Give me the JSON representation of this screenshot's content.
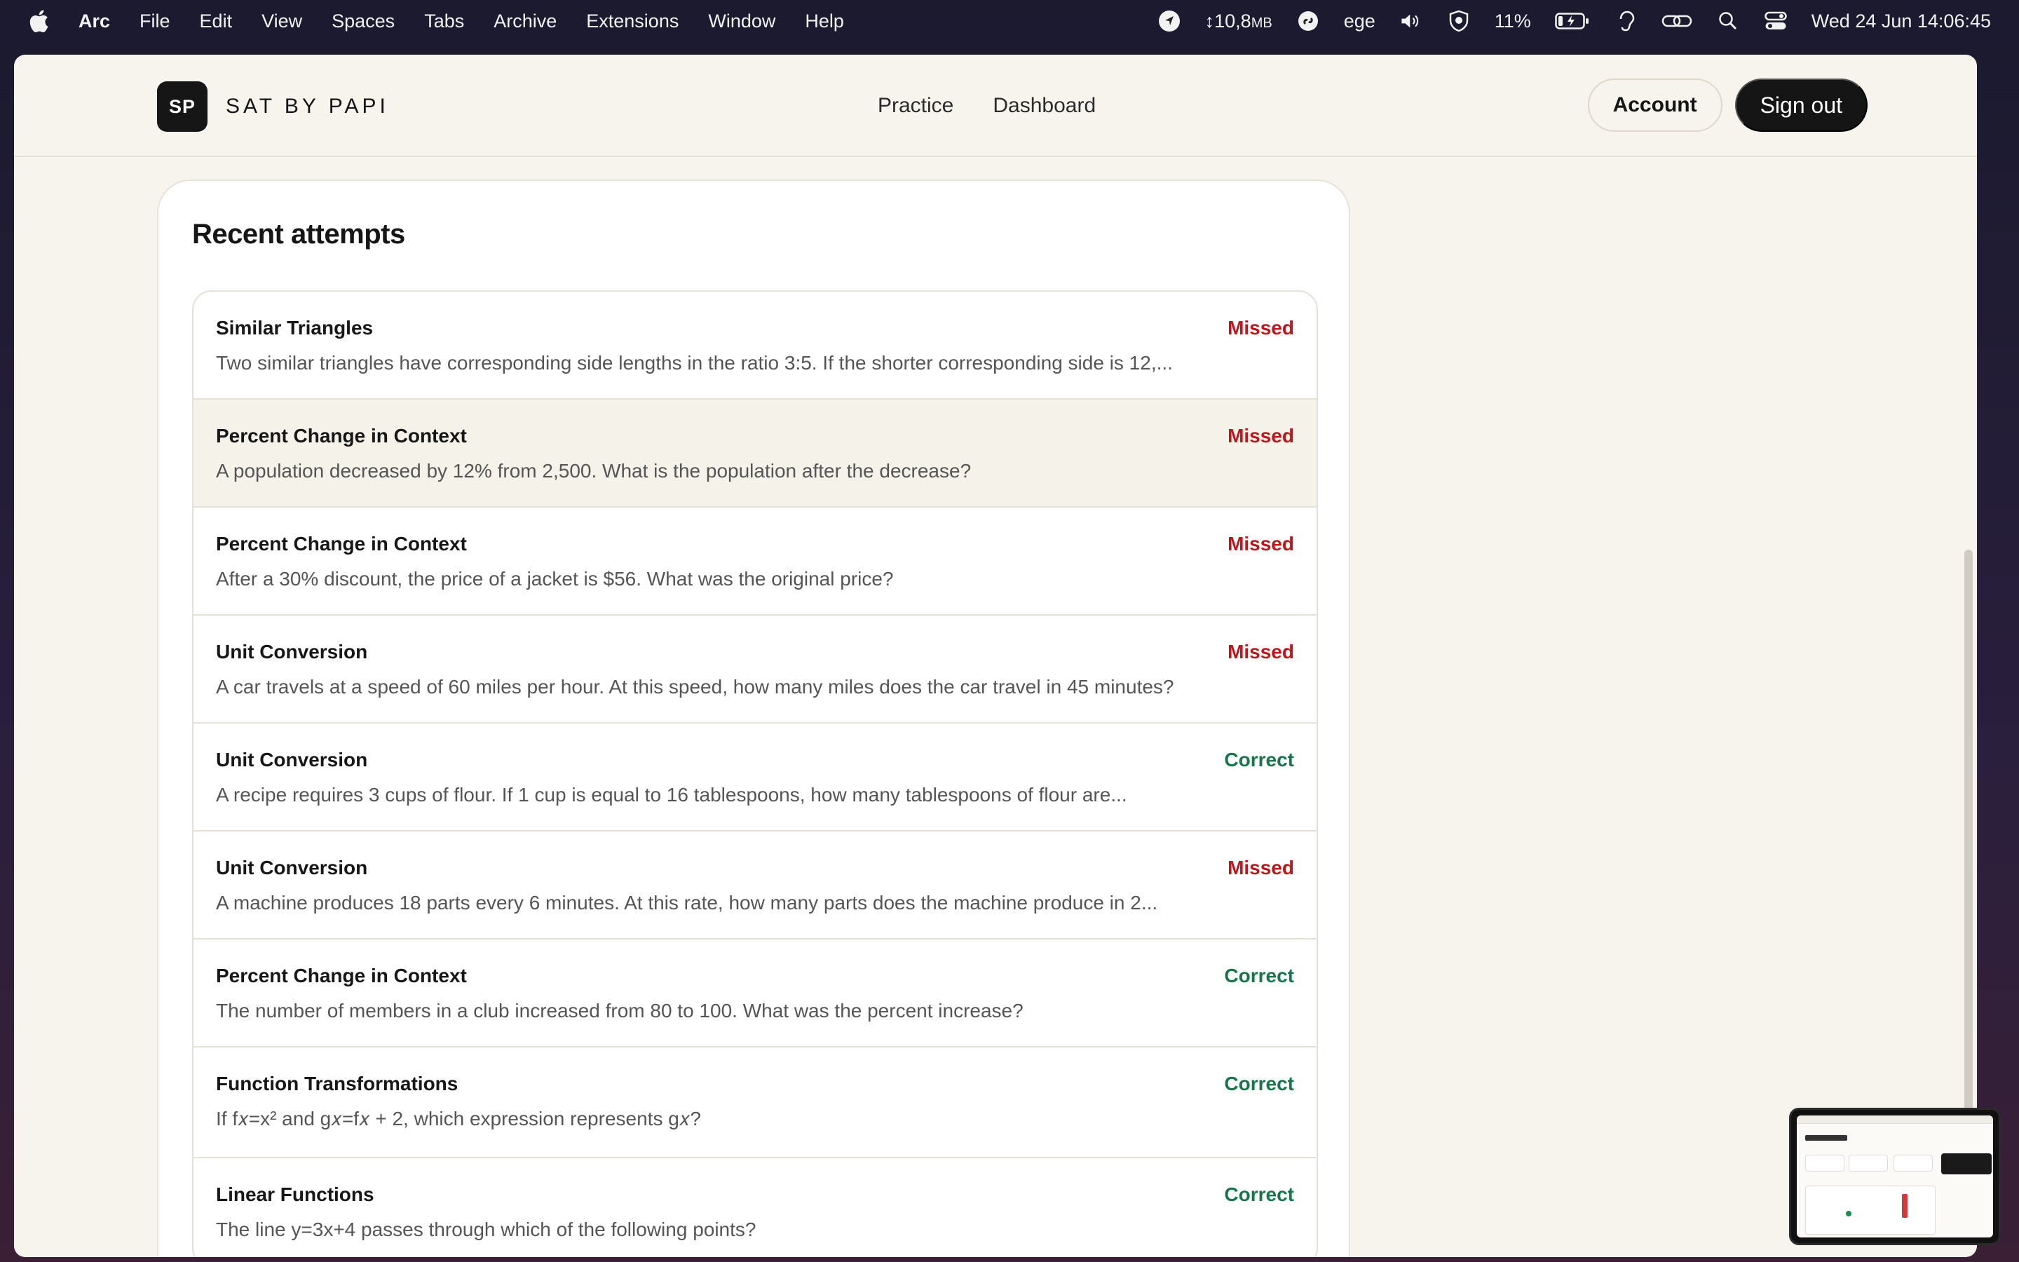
{
  "menubar": {
    "app_name": "Arc",
    "menus": [
      "File",
      "Edit",
      "View",
      "Spaces",
      "Tabs",
      "Archive",
      "Extensions",
      "Window",
      "Help"
    ],
    "network_rate": "↕10,8",
    "network_unit": "MB",
    "keyboard_label": "ege",
    "battery_percent": "11%",
    "datetime": "Wed 24 Jun  14:06:45"
  },
  "header": {
    "logo_initials": "SP",
    "brand_name": "SAT BY PAPI",
    "nav": [
      "Practice",
      "Dashboard"
    ],
    "account_label": "Account",
    "signout_label": "Sign out"
  },
  "recent": {
    "title": "Recent attempts",
    "attempts": [
      {
        "topic": "Similar Triangles",
        "question": "Two similar triangles have corresponding side lengths in the ratio 3:5. If the shorter corresponding side is 12,...",
        "status": "Missed"
      },
      {
        "topic": "Percent Change in Context",
        "question": "A population decreased by 12% from 2,500. What is the population after the decrease?",
        "status": "Missed"
      },
      {
        "topic": "Percent Change in Context",
        "question": "After a 30% discount, the price of a jacket is $56. What was the original price?",
        "status": "Missed"
      },
      {
        "topic": "Unit Conversion",
        "question": "A car travels at a speed of 60 miles per hour. At this speed, how many miles does the car travel in 45 minutes?",
        "status": "Missed"
      },
      {
        "topic": "Unit Conversion",
        "question": "A recipe requires 3 cups of flour. If 1 cup is equal to 16 tablespoons, how many tablespoons of flour are...",
        "status": "Correct"
      },
      {
        "topic": "Unit Conversion",
        "question": "A machine produces 18 parts every 6 minutes. At this rate, how many parts does the machine produce in 2...",
        "status": "Missed"
      },
      {
        "topic": "Percent Change in Context",
        "question": "The number of members in a club increased from 80 to 100. What was the percent increase?",
        "status": "Correct"
      },
      {
        "topic": "Function Transformations",
        "question": "If f𝑥=x² and g𝑥=f𝑥 + 2, which expression represents g𝑥?",
        "status": "Correct"
      },
      {
        "topic": "Linear Functions",
        "question": "The line y=3x+4 passes through which of the following points?",
        "status": "Correct"
      }
    ]
  },
  "colors": {
    "missed": "#c4141b",
    "correct": "#17774a",
    "page_bg": "#f7f4ee"
  }
}
